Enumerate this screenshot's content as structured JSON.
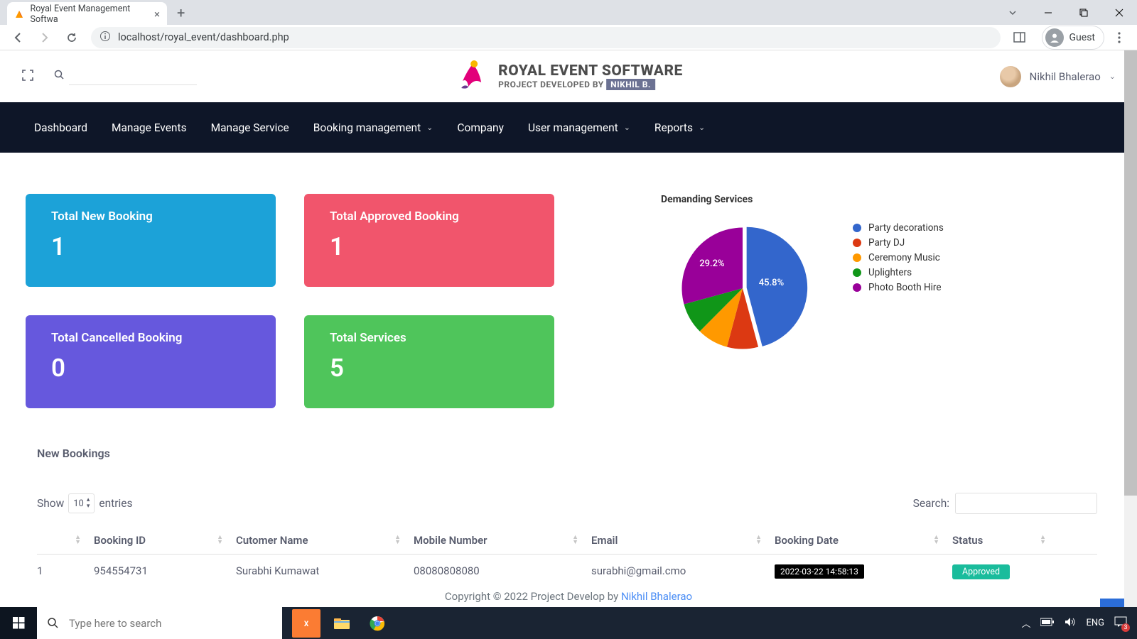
{
  "browser": {
    "tab_title": "Royal Event Management Softwa",
    "url": "localhost/royal_event/dashboard.php",
    "guest_label": "Guest"
  },
  "header": {
    "logo_title": "ROYAL EVENT SOFTWARE",
    "logo_sub_prefix": "PROJECT DEVELOPED BY",
    "logo_sub_name": "NIKHIL B.",
    "user_name": "Nikhil Bhalerao"
  },
  "nav": {
    "items": [
      "Dashboard",
      "Manage Events",
      "Manage Service",
      "Booking management",
      "Company",
      "User management",
      "Reports"
    ],
    "has_dropdown": [
      false,
      false,
      false,
      true,
      false,
      true,
      true
    ]
  },
  "stats": [
    {
      "label": "Total New Booking",
      "value": "1",
      "color": "blue"
    },
    {
      "label": "Total Approved Booking",
      "value": "1",
      "color": "red"
    },
    {
      "label": "Total Cancelled Booking",
      "value": "0",
      "color": "purple"
    },
    {
      "label": "Total Services",
      "value": "5",
      "color": "green"
    }
  ],
  "chart_data": {
    "type": "pie",
    "title": "Demanding Services",
    "series": [
      {
        "name": "Party decorations",
        "value": 45.8,
        "color": "#3366cc"
      },
      {
        "name": "Party DJ",
        "value": 8.3,
        "color": "#dc3912"
      },
      {
        "name": "Ceremony Music",
        "value": 8.3,
        "color": "#ff9900"
      },
      {
        "name": "Uplighters",
        "value": 8.3,
        "color": "#109618"
      },
      {
        "name": "Photo Booth Hire",
        "value": 29.2,
        "color": "#990099"
      }
    ],
    "visible_labels": [
      "45.8%",
      "29.2%"
    ]
  },
  "bookings": {
    "section_title": "New Bookings",
    "show_label": "Show",
    "entries_label": "entries",
    "entries_value": "10",
    "search_label": "Search:",
    "columns": [
      "",
      "Booking ID",
      "Cutomer Name",
      "Mobile Number",
      "Email",
      "Booking Date",
      "Status"
    ],
    "rows": [
      {
        "idx": "1",
        "id": "954554731",
        "name": "Surabhi Kumawat",
        "mobile": "08080808080",
        "email": "surabhi@gmail.cmo",
        "date": "2022-03-22 14:58:13",
        "status": "Approved"
      }
    ]
  },
  "footer": {
    "text": "Copyright © 2022 Project Develop by ",
    "link": "Nikhil Bhalerao"
  },
  "taskbar": {
    "search_placeholder": "Type here to search",
    "lang": "ENG"
  }
}
